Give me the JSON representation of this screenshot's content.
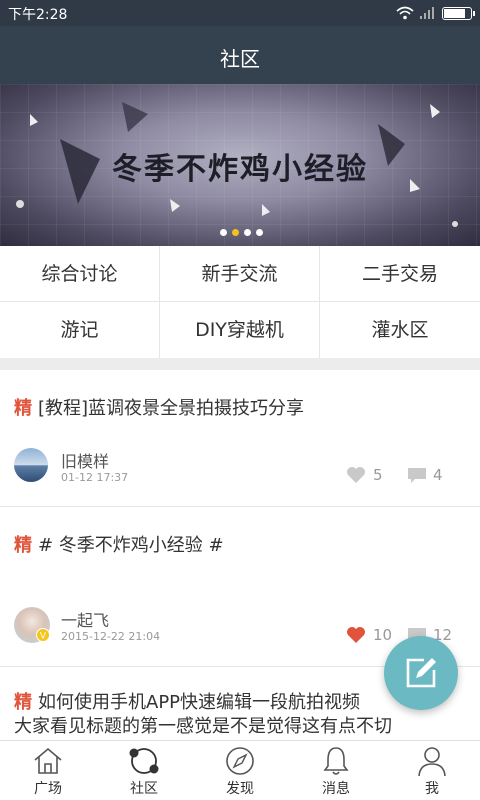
{
  "status_bar": {
    "time": "下午2:28",
    "battery_level": 0.85
  },
  "header": {
    "title": "社区"
  },
  "banner": {
    "text": "冬季不炸鸡小经验",
    "slides": 4,
    "active_slide": 1
  },
  "categories": [
    "综合讨论",
    "新手交流",
    "二手交易",
    "游记",
    "DIY穿越机",
    "灌水区"
  ],
  "posts": [
    {
      "badge": "精",
      "title_lines": [
        "[教程]蓝调夜景全景拍摄技巧分享"
      ],
      "author": "旧模样",
      "date": "01-12 17:37",
      "likes": "5",
      "comments": "4",
      "liked": false
    },
    {
      "badge": "精",
      "title_lines": [
        "# 冬季不炸鸡小经验 #"
      ],
      "author": "一起飞",
      "date": "2015-12-22 21:04",
      "likes": "10",
      "comments": "12",
      "liked": true
    },
    {
      "badge": "精",
      "title_lines": [
        "如何使用手机APP快速编辑一段航拍视频",
        "大家看见标题的第一感觉是不是觉得这有点不切"
      ]
    }
  ],
  "tabs": [
    {
      "label": "广场",
      "icon": "home-icon"
    },
    {
      "label": "社区",
      "icon": "community-icon"
    },
    {
      "label": "发现",
      "icon": "compass-icon"
    },
    {
      "label": "消息",
      "icon": "bell-icon"
    },
    {
      "label": "我",
      "icon": "person-icon"
    }
  ],
  "colors": {
    "header_bg": "#34414e",
    "accent_red": "#e0543b",
    "fab": "#6bb9c3",
    "banner_dot_active": "#f3c21d"
  }
}
